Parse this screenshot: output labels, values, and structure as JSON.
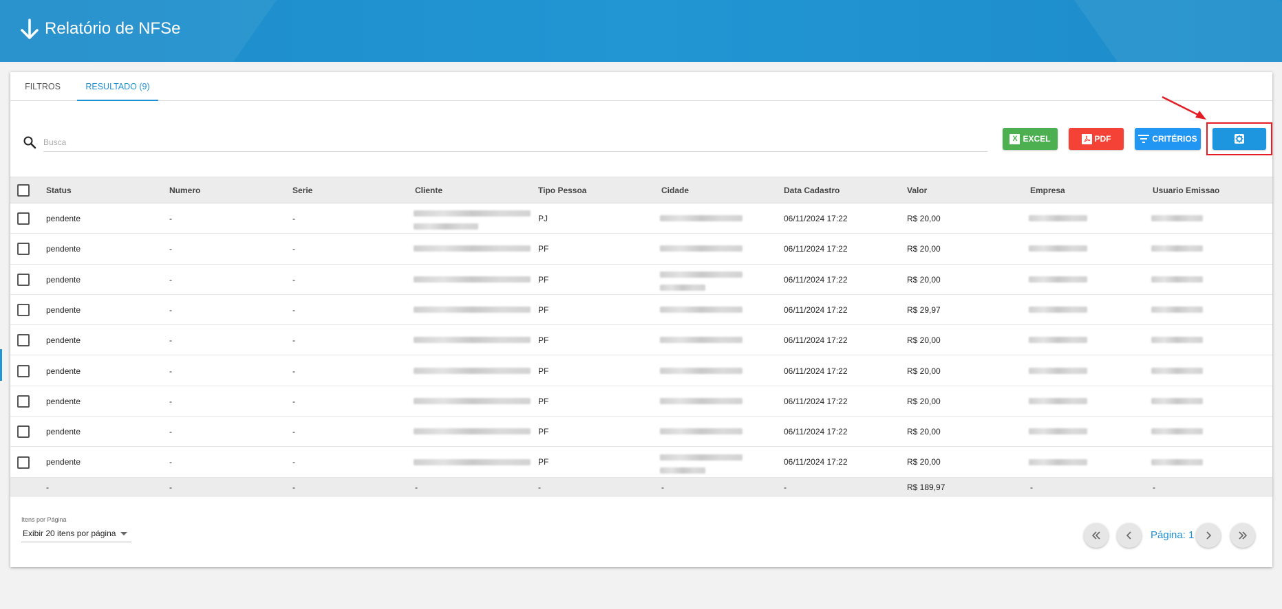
{
  "header": {
    "title": "Relatório de NFSe"
  },
  "tabs": [
    {
      "label": "FILTROS",
      "active": false
    },
    {
      "label": "RESULTADO (9)",
      "active": true
    }
  ],
  "search": {
    "placeholder": "Busca",
    "value": ""
  },
  "toolbar": {
    "excel_label": "EXCEL",
    "pdf_label": "PDF",
    "criteria_label": "CRITÉRIOS"
  },
  "table": {
    "columns": [
      "Status",
      "Numero",
      "Serie",
      "Cliente",
      "Tipo Pessoa",
      "Cidade",
      "Data Cadastro",
      "Valor",
      "Empresa",
      "Usuario Emissao"
    ],
    "rows": [
      {
        "status": "pendente",
        "numero": "-",
        "serie": "-",
        "tipo": "PJ",
        "data": "06/11/2024 17:22",
        "valor": "R$ 20,00"
      },
      {
        "status": "pendente",
        "numero": "-",
        "serie": "-",
        "tipo": "PF",
        "data": "06/11/2024 17:22",
        "valor": "R$ 20,00"
      },
      {
        "status": "pendente",
        "numero": "-",
        "serie": "-",
        "tipo": "PF",
        "data": "06/11/2024 17:22",
        "valor": "R$ 20,00"
      },
      {
        "status": "pendente",
        "numero": "-",
        "serie": "-",
        "tipo": "PF",
        "data": "06/11/2024 17:22",
        "valor": "R$ 29,97"
      },
      {
        "status": "pendente",
        "numero": "-",
        "serie": "-",
        "tipo": "PF",
        "data": "06/11/2024 17:22",
        "valor": "R$ 20,00"
      },
      {
        "status": "pendente",
        "numero": "-",
        "serie": "-",
        "tipo": "PF",
        "data": "06/11/2024 17:22",
        "valor": "R$ 20,00"
      },
      {
        "status": "pendente",
        "numero": "-",
        "serie": "-",
        "tipo": "PF",
        "data": "06/11/2024 17:22",
        "valor": "R$ 20,00"
      },
      {
        "status": "pendente",
        "numero": "-",
        "serie": "-",
        "tipo": "PF",
        "data": "06/11/2024 17:22",
        "valor": "R$ 20,00"
      },
      {
        "status": "pendente",
        "numero": "-",
        "serie": "-",
        "tipo": "PF",
        "data": "06/11/2024 17:22",
        "valor": "R$ 20,00"
      }
    ],
    "totals": [
      "-",
      "-",
      "-",
      "-",
      "-",
      "-",
      "-",
      "R$ 189,97",
      "-",
      "-"
    ]
  },
  "pagination": {
    "items_per_page_label": "Itens por Página",
    "items_per_page_value": "Exibir 20 itens por página",
    "page_label": "Página: 1"
  },
  "colors": {
    "header": "#1d8cc9",
    "excel": "#4caf50",
    "pdf": "#f44336",
    "criteria": "#2196f3",
    "highlight": "#e51c23"
  },
  "icons": [
    "arrow-down-icon",
    "search-icon",
    "excel-icon",
    "pdf-icon",
    "filter-icon",
    "gear-icon",
    "first-page-icon",
    "prev-page-icon",
    "next-page-icon",
    "last-page-icon",
    "chevron-down-icon"
  ]
}
